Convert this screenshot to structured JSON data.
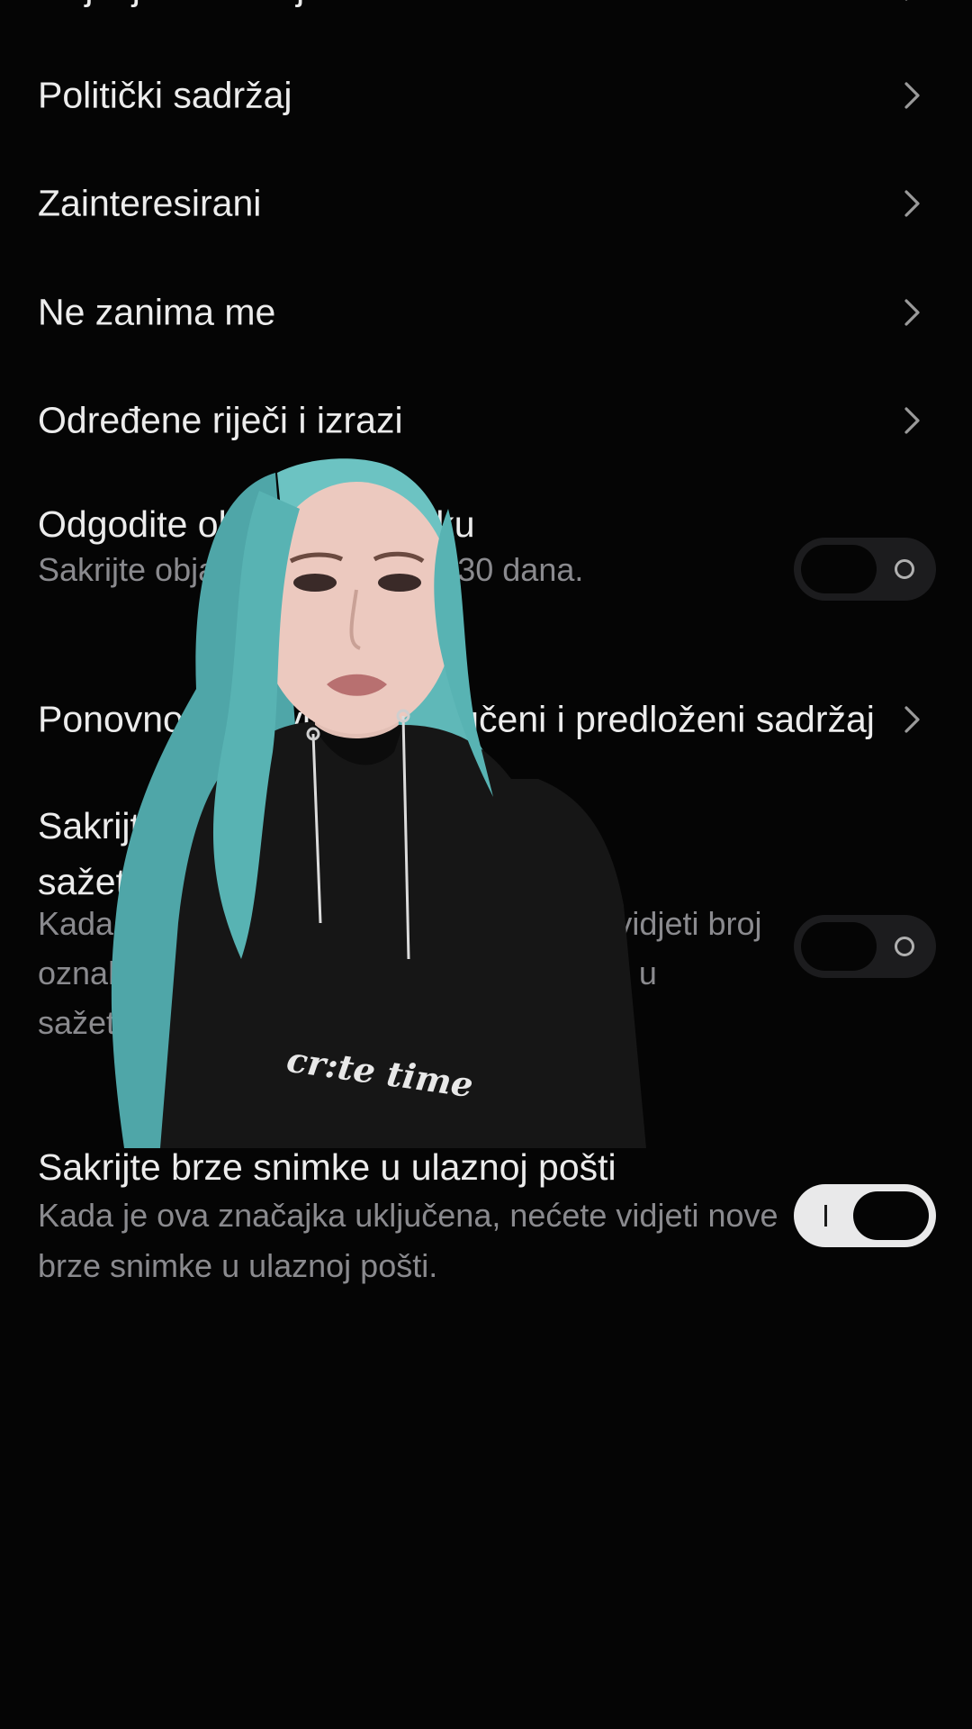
{
  "menu": {
    "items": [
      {
        "label": "Politički sadržaj"
      },
      {
        "label": "Zainteresirani"
      },
      {
        "label": "Ne zanima me"
      },
      {
        "label": "Određene riječi i izrazi"
      }
    ],
    "cut_off_top_label": "Osjetljivi sadržaj"
  },
  "snooze": {
    "title": "Odgodite objave u sažetku",
    "description": "Sakrijte objave iz sažetka na 30 dana.",
    "toggle_on": false
  },
  "reset": {
    "label": "Ponovno postavite preporučeni i predloženi sadržaj"
  },
  "hide_likes": {
    "title": "Sakrijte broj oznaka sviđa mi se u sažetku",
    "description": "Kada je ova značajka uključena, nećete vidjeti broj oznaka \"sviđa mi se\" na objavama drugih u sažetku.",
    "toggle_on": false
  },
  "hide_snaps": {
    "title": "Sakrijte brze snimke u ulaznoj pošti",
    "description": "Kada je ova značajka uključena, nećete vidjeti nove brze snimke u ulaznoj pošti.",
    "toggle_on": true
  },
  "overlay": {
    "hoodie_print": "cr:te time"
  },
  "colors": {
    "background": "#050505",
    "text_primary": "#ececec",
    "text_secondary": "#8a8a8e",
    "toggle_on_track": "#e9e9ea",
    "toggle_off_track": "#1c1c1e",
    "hair": "#5fb8b8"
  },
  "icons": {
    "chevron": "chevron-right-icon"
  }
}
